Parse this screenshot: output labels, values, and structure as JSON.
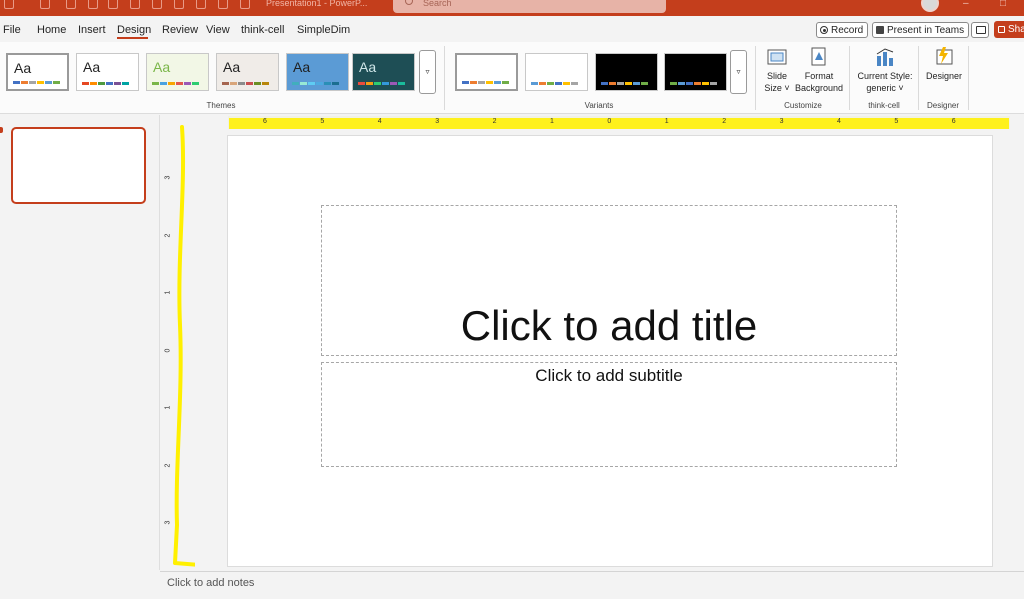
{
  "titlebar": {
    "doc_title": "Presentation1 - PowerP...",
    "search_placeholder": "Search"
  },
  "tabs": [
    "File",
    "Home",
    "Insert",
    "Design",
    "Review",
    "View",
    "think-cell",
    "SimpleDim"
  ],
  "active_tab": "Design",
  "header_buttons": {
    "record": "Record",
    "present_in_teams": "Present in Teams",
    "share": "Sha"
  },
  "themes": {
    "group_label": "Themes",
    "items": [
      {
        "label": "Aa",
        "bg": "#ffffff",
        "text": "#222222",
        "swatches": [
          "#4472c4",
          "#ed7d31",
          "#a5a5a5",
          "#ffc000",
          "#5b9bd5",
          "#70ad47"
        ]
      },
      {
        "label": "Aa",
        "bg": "#ffffff",
        "text": "#222222",
        "swatches": [
          "#e64823",
          "#ff8c00",
          "#4e9a3f",
          "#4472c4",
          "#7a5195",
          "#00a3a3"
        ]
      },
      {
        "label": "Aa",
        "bg": "#f2f7e6",
        "text": "#7ab648",
        "swatches": [
          "#7ab648",
          "#4aa3df",
          "#f7a600",
          "#e2574c",
          "#9b59b6",
          "#2ecc71"
        ]
      },
      {
        "label": "Aa",
        "bg": "#f0ece8",
        "text": "#222222",
        "swatches": [
          "#a5644e",
          "#d9a57a",
          "#8c8c8c",
          "#c94f4f",
          "#6b8e23",
          "#b8860b"
        ]
      },
      {
        "label": "Aa",
        "bg": "#5b9bd5",
        "text": "#1f1f1f",
        "swatches": [
          "#41aebd",
          "#97e9d5",
          "#5eccf3",
          "#4da9e0",
          "#2a8fb6",
          "#1b6e91"
        ]
      },
      {
        "label": "Aa",
        "bg": "#1e4e55",
        "text": "#cfe6e8",
        "swatches": [
          "#e84c3d",
          "#f39c12",
          "#2ecc71",
          "#3498db",
          "#9b59b6",
          "#1abc9c"
        ]
      }
    ]
  },
  "variants": {
    "group_label": "Variants",
    "items": [
      {
        "bg": "#ffffff",
        "swatches": [
          "#4472c4",
          "#ed7d31",
          "#a5a5a5",
          "#ffc000",
          "#5b9bd5",
          "#70ad47"
        ]
      },
      {
        "bg": "#ffffff",
        "swatches": [
          "#5b9bd5",
          "#ed7d31",
          "#70ad47",
          "#4472c4",
          "#ffc000",
          "#a5a5a5"
        ]
      },
      {
        "bg": "#000000",
        "swatches": [
          "#4472c4",
          "#ed7d31",
          "#a5a5a5",
          "#ffc000",
          "#5b9bd5",
          "#70ad47"
        ]
      },
      {
        "bg": "#000000",
        "swatches": [
          "#70ad47",
          "#5b9bd5",
          "#4472c4",
          "#ed7d31",
          "#ffc000",
          "#a5a5a5"
        ]
      }
    ]
  },
  "customize": {
    "group_label": "Customize",
    "slide_size": [
      "Slide",
      "Size ˅"
    ],
    "format_background": [
      "Format",
      "Background"
    ]
  },
  "thinkcell": {
    "group_label": "think-cell",
    "current_style": [
      "Current Style:",
      "generic ˅"
    ]
  },
  "designer": {
    "group_label": "Designer",
    "button": "Designer"
  },
  "ruler_h": [
    "6",
    "5",
    "4",
    "3",
    "2",
    "1",
    "0",
    "1",
    "2",
    "3",
    "4",
    "5",
    "6"
  ],
  "ruler_v": [
    "3",
    "2",
    "1",
    "0",
    "1",
    "2",
    "3"
  ],
  "slide": {
    "title_placeholder": "Click to add title",
    "subtitle_placeholder": "Click to add subtitle"
  },
  "notes_placeholder": "Click to add notes",
  "colors": {
    "accent": "#c43e1c",
    "highlight": "#fff000"
  }
}
